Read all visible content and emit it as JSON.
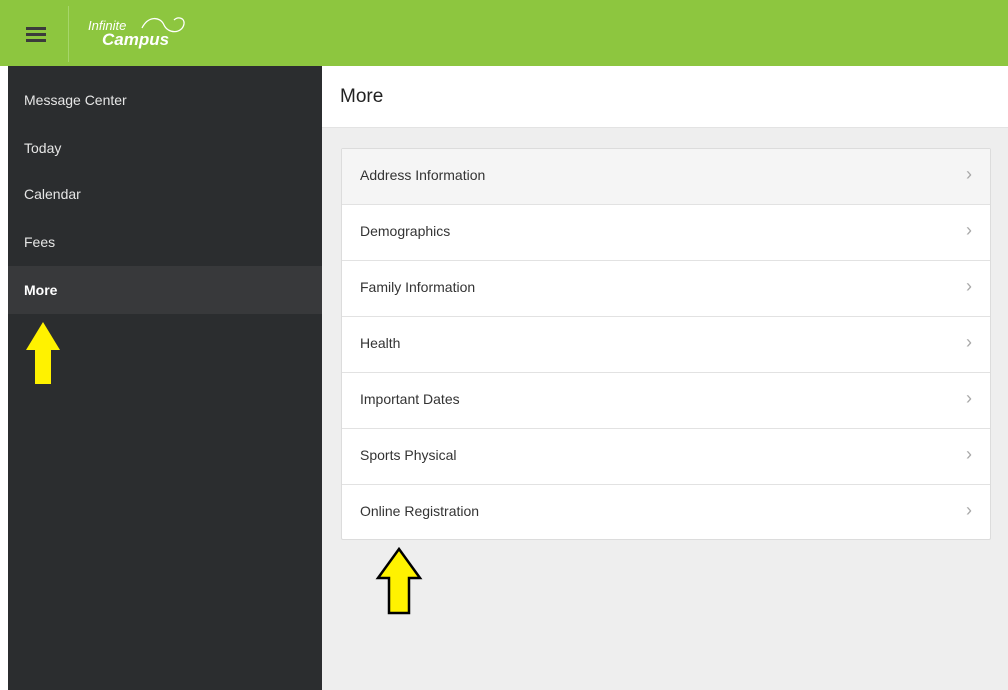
{
  "app": {
    "logo_line1": "Infinite",
    "logo_line2": "Campus"
  },
  "sidebar": {
    "items": [
      {
        "label": "Message Center",
        "active": false
      },
      {
        "label": "Today",
        "active": false
      },
      {
        "label": "Calendar",
        "active": false
      },
      {
        "label": "Fees",
        "active": false
      },
      {
        "label": "More",
        "active": true
      }
    ]
  },
  "main": {
    "title": "More",
    "rows": [
      {
        "label": "Address Information"
      },
      {
        "label": "Demographics"
      },
      {
        "label": "Family Information"
      },
      {
        "label": "Health"
      },
      {
        "label": "Important Dates"
      },
      {
        "label": "Sports Physical"
      },
      {
        "label": "Online Registration"
      }
    ],
    "chevron": "›"
  },
  "colors": {
    "topbar": "#8dc63f",
    "sidebar": "#2b2d2f",
    "annotation_arrow": "#fff200"
  }
}
